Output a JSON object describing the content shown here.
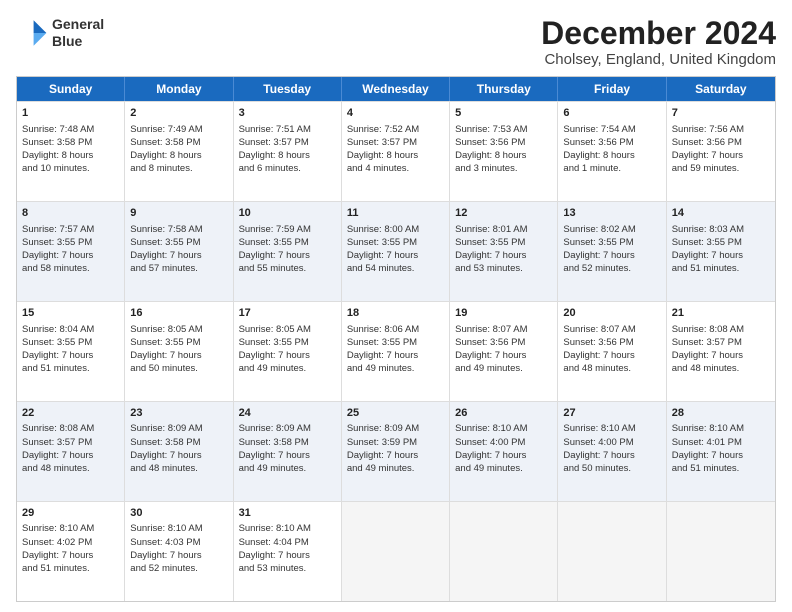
{
  "logo": {
    "line1": "General",
    "line2": "Blue"
  },
  "title": "December 2024",
  "location": "Cholsey, England, United Kingdom",
  "days": [
    "Sunday",
    "Monday",
    "Tuesday",
    "Wednesday",
    "Thursday",
    "Friday",
    "Saturday"
  ],
  "rows": [
    [
      {
        "day": "",
        "data": ""
      },
      {
        "day": "2",
        "data": "Sunrise: 7:49 AM\nSunset: 3:58 PM\nDaylight: 8 hours\nand 8 minutes."
      },
      {
        "day": "3",
        "data": "Sunrise: 7:51 AM\nSunset: 3:57 PM\nDaylight: 8 hours\nand 6 minutes."
      },
      {
        "day": "4",
        "data": "Sunrise: 7:52 AM\nSunset: 3:57 PM\nDaylight: 8 hours\nand 4 minutes."
      },
      {
        "day": "5",
        "data": "Sunrise: 7:53 AM\nSunset: 3:56 PM\nDaylight: 8 hours\nand 3 minutes."
      },
      {
        "day": "6",
        "data": "Sunrise: 7:54 AM\nSunset: 3:56 PM\nDaylight: 8 hours\nand 1 minute."
      },
      {
        "day": "7",
        "data": "Sunrise: 7:56 AM\nSunset: 3:56 PM\nDaylight: 7 hours\nand 59 minutes."
      }
    ],
    [
      {
        "day": "8",
        "data": "Sunrise: 7:57 AM\nSunset: 3:55 PM\nDaylight: 7 hours\nand 58 minutes."
      },
      {
        "day": "9",
        "data": "Sunrise: 7:58 AM\nSunset: 3:55 PM\nDaylight: 7 hours\nand 57 minutes."
      },
      {
        "day": "10",
        "data": "Sunrise: 7:59 AM\nSunset: 3:55 PM\nDaylight: 7 hours\nand 55 minutes."
      },
      {
        "day": "11",
        "data": "Sunrise: 8:00 AM\nSunset: 3:55 PM\nDaylight: 7 hours\nand 54 minutes."
      },
      {
        "day": "12",
        "data": "Sunrise: 8:01 AM\nSunset: 3:55 PM\nDaylight: 7 hours\nand 53 minutes."
      },
      {
        "day": "13",
        "data": "Sunrise: 8:02 AM\nSunset: 3:55 PM\nDaylight: 7 hours\nand 52 minutes."
      },
      {
        "day": "14",
        "data": "Sunrise: 8:03 AM\nSunset: 3:55 PM\nDaylight: 7 hours\nand 51 minutes."
      }
    ],
    [
      {
        "day": "15",
        "data": "Sunrise: 8:04 AM\nSunset: 3:55 PM\nDaylight: 7 hours\nand 51 minutes."
      },
      {
        "day": "16",
        "data": "Sunrise: 8:05 AM\nSunset: 3:55 PM\nDaylight: 7 hours\nand 50 minutes."
      },
      {
        "day": "17",
        "data": "Sunrise: 8:05 AM\nSunset: 3:55 PM\nDaylight: 7 hours\nand 49 minutes."
      },
      {
        "day": "18",
        "data": "Sunrise: 8:06 AM\nSunset: 3:55 PM\nDaylight: 7 hours\nand 49 minutes."
      },
      {
        "day": "19",
        "data": "Sunrise: 8:07 AM\nSunset: 3:56 PM\nDaylight: 7 hours\nand 49 minutes."
      },
      {
        "day": "20",
        "data": "Sunrise: 8:07 AM\nSunset: 3:56 PM\nDaylight: 7 hours\nand 48 minutes."
      },
      {
        "day": "21",
        "data": "Sunrise: 8:08 AM\nSunset: 3:57 PM\nDaylight: 7 hours\nand 48 minutes."
      }
    ],
    [
      {
        "day": "22",
        "data": "Sunrise: 8:08 AM\nSunset: 3:57 PM\nDaylight: 7 hours\nand 48 minutes."
      },
      {
        "day": "23",
        "data": "Sunrise: 8:09 AM\nSunset: 3:58 PM\nDaylight: 7 hours\nand 48 minutes."
      },
      {
        "day": "24",
        "data": "Sunrise: 8:09 AM\nSunset: 3:58 PM\nDaylight: 7 hours\nand 49 minutes."
      },
      {
        "day": "25",
        "data": "Sunrise: 8:09 AM\nSunset: 3:59 PM\nDaylight: 7 hours\nand 49 minutes."
      },
      {
        "day": "26",
        "data": "Sunrise: 8:10 AM\nSunset: 4:00 PM\nDaylight: 7 hours\nand 49 minutes."
      },
      {
        "day": "27",
        "data": "Sunrise: 8:10 AM\nSunset: 4:00 PM\nDaylight: 7 hours\nand 50 minutes."
      },
      {
        "day": "28",
        "data": "Sunrise: 8:10 AM\nSunset: 4:01 PM\nDaylight: 7 hours\nand 51 minutes."
      }
    ],
    [
      {
        "day": "29",
        "data": "Sunrise: 8:10 AM\nSunset: 4:02 PM\nDaylight: 7 hours\nand 51 minutes."
      },
      {
        "day": "30",
        "data": "Sunrise: 8:10 AM\nSunset: 4:03 PM\nDaylight: 7 hours\nand 52 minutes."
      },
      {
        "day": "31",
        "data": "Sunrise: 8:10 AM\nSunset: 4:04 PM\nDaylight: 7 hours\nand 53 minutes."
      },
      {
        "day": "",
        "data": ""
      },
      {
        "day": "",
        "data": ""
      },
      {
        "day": "",
        "data": ""
      },
      {
        "day": "",
        "data": ""
      }
    ]
  ],
  "row0_sunday": {
    "day": "1",
    "data": "Sunrise: 7:48 AM\nSunset: 3:58 PM\nDaylight: 8 hours\nand 10 minutes."
  }
}
